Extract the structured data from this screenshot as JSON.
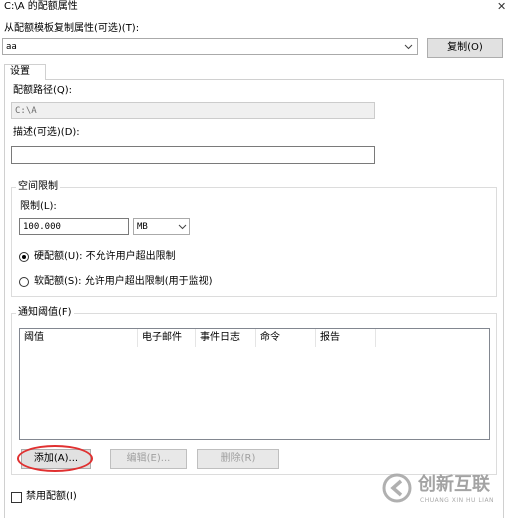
{
  "window": {
    "title": "C:\\A 的配额属性",
    "close_glyph": "✕"
  },
  "template": {
    "label": "从配额模板复制属性(可选)(T):",
    "selected_value": "aa",
    "copy_button": "复制(O)"
  },
  "tabs": [
    {
      "label": "设置"
    }
  ],
  "settings": {
    "path_label": "配额路径(Q):",
    "path_value": "C:\\A",
    "description_label": "描述(可选)(D):",
    "description_value": "",
    "space_limit": {
      "group_label": "空间限制",
      "limit_label": "限制(L):",
      "limit_value": "100.000",
      "unit_value": "MB",
      "hard_quota_label": "硬配额(U): 不允许用户超出限制",
      "soft_quota_label": "软配额(S): 允许用户超出限制(用于监视)",
      "selected": "hard"
    },
    "notification": {
      "group_label": "通知阈值(F)",
      "columns": [
        "阈值",
        "电子邮件",
        "事件日志",
        "命令",
        "报告"
      ],
      "rows": [],
      "add_button": "添加(A)...",
      "edit_button": "编辑(E)...",
      "delete_button": "删除(R)"
    },
    "disable_quota_label": "禁用配额(I)",
    "disable_quota_checked": false
  },
  "watermark": {
    "brand": "创新互联",
    "sub": "CHUANG XIN HU LIAN"
  },
  "colors": {
    "highlight_ellipse": "#e03030",
    "watermark": "#b0b0b0"
  }
}
